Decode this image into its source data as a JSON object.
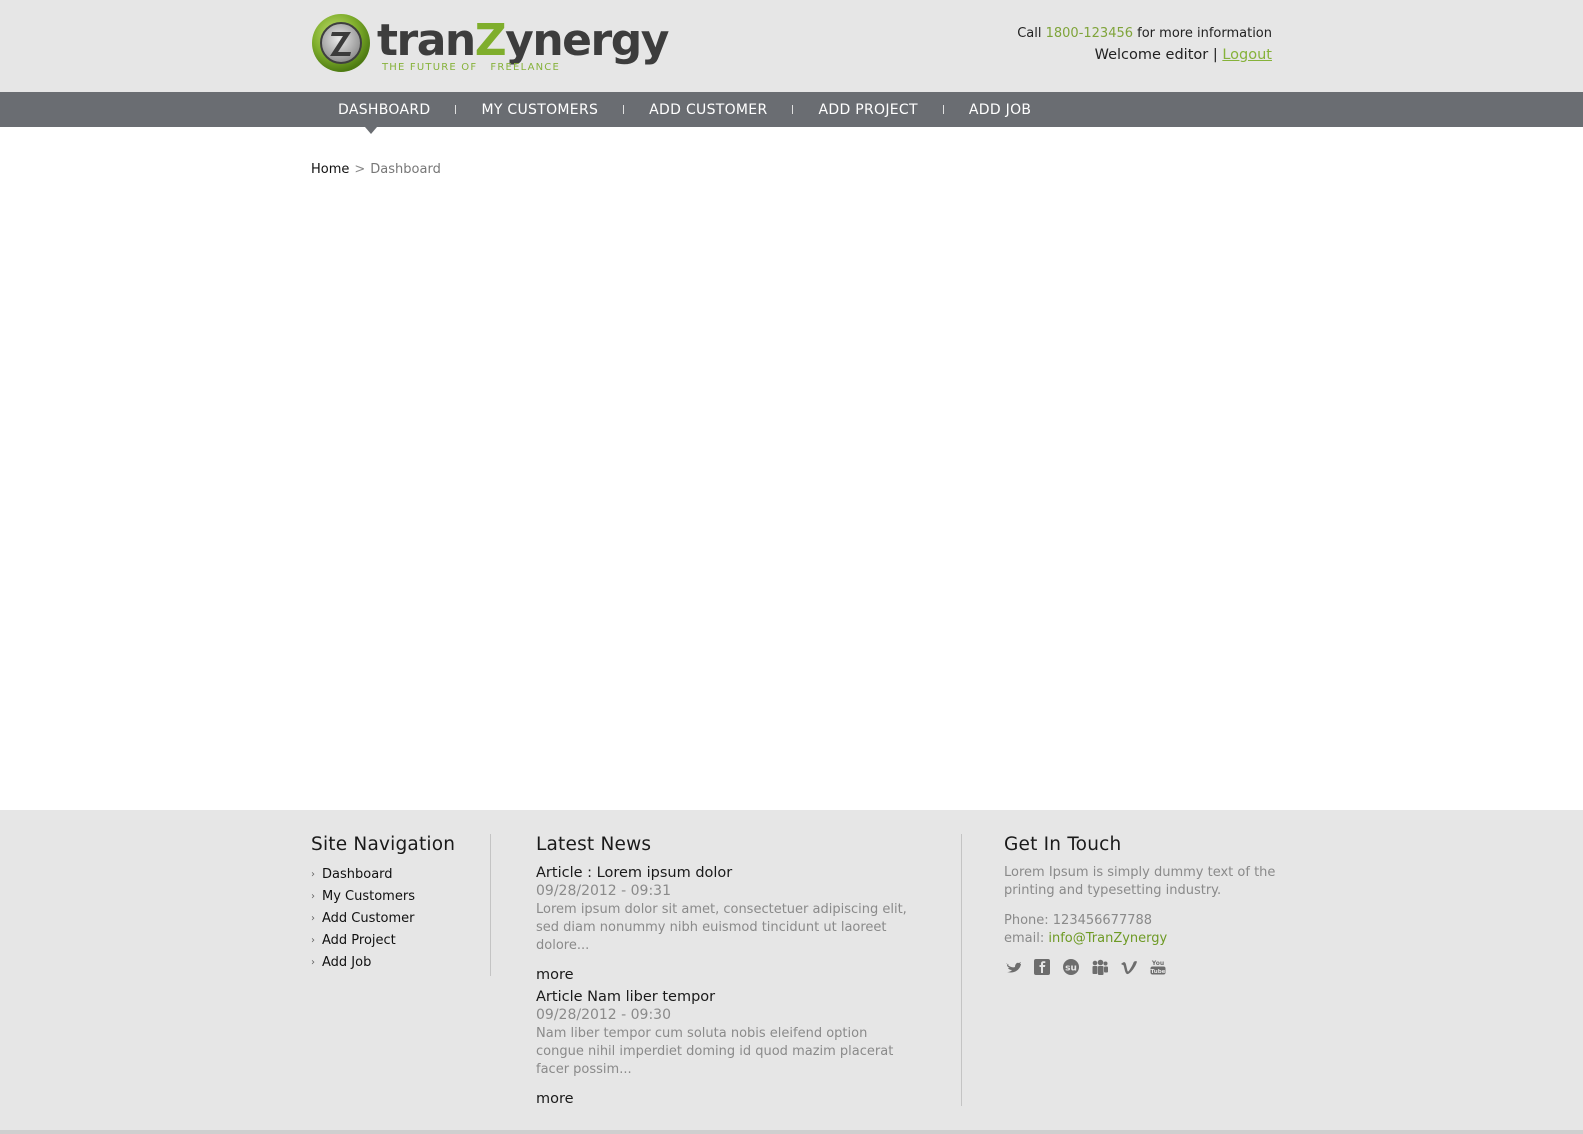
{
  "brand": {
    "name_part1": "tran",
    "name_part2": "Z",
    "name_part3": "ynergy",
    "tagline": "THE FUTURE OF   FREELANCE",
    "colors": {
      "accent": "#7fae2c",
      "nav_bg": "#6a6d72",
      "header_bg": "#e6e6e6"
    }
  },
  "contact": {
    "call_prefix": "Call",
    "phone": "1800-123456",
    "call_suffix": "for more information",
    "welcome": "Welcome editor",
    "separator": "|",
    "logout": "Logout"
  },
  "nav": {
    "items": [
      {
        "label": "DASHBOARD"
      },
      {
        "label": "MY CUSTOMERS"
      },
      {
        "label": "ADD CUSTOMER"
      },
      {
        "label": "ADD PROJECT"
      },
      {
        "label": "ADD JOB"
      }
    ]
  },
  "breadcrumb": {
    "home": "Home",
    "separator": ">",
    "current": "Dashboard"
  },
  "footer": {
    "site_nav": {
      "title": "Site Navigation",
      "items": [
        "Dashboard",
        "My Customers",
        "Add Customer",
        "Add Project",
        "Add Job"
      ]
    },
    "news": {
      "title": "Latest News",
      "items": [
        {
          "title": "Article : Lorem ipsum dolor",
          "date": "09/28/2012 - 09:31",
          "body": "Lorem ipsum dolor sit amet, consectetuer adipiscing elit, sed diam nonummy nibh euismod tincidunt ut laoreet dolore...",
          "more": "more"
        },
        {
          "title": "Article Nam liber tempor",
          "date": "09/28/2012 - 09:30",
          "body": "Nam liber tempor cum soluta nobis eleifend option congue nihil imperdiet doming id quod mazim placerat facer possim...",
          "more": "more"
        }
      ]
    },
    "touch": {
      "title": "Get In Touch",
      "text": "Lorem Ipsum is simply dummy text of the printing and typesetting industry.",
      "phone": "Phone: 123456677788",
      "email_label": "email:",
      "email": "info@TranZynergy",
      "social": [
        "twitter-icon",
        "facebook-icon",
        "stumbleupon-icon",
        "myspace-icon",
        "vimeo-icon",
        "youtube-icon"
      ]
    }
  }
}
